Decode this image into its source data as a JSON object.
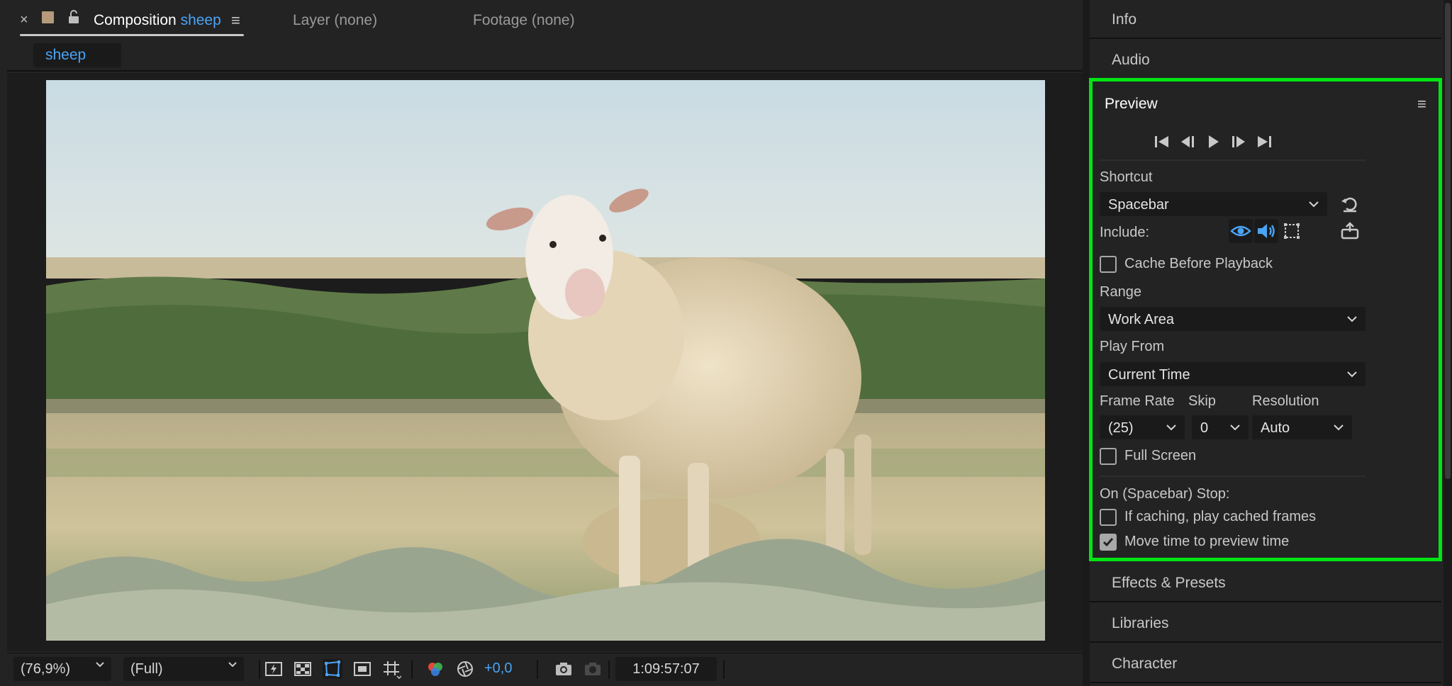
{
  "composition_panel": {
    "tabs": {
      "composition_prefix": "Composition",
      "composition_name": "sheep",
      "layer": "Layer (none)",
      "footage": "Footage (none)"
    },
    "breadcrumb": "sheep",
    "image_description_icon": "sheep-photo",
    "footer": {
      "zoom": "(76,9%)",
      "resolution": "(Full)",
      "exposure": "+0,0",
      "timecode": "1:09:57:07"
    }
  },
  "right_panels": {
    "info": "Info",
    "audio": "Audio",
    "effects": "Effects & Presets",
    "libraries": "Libraries",
    "character": "Character"
  },
  "preview": {
    "title": "Preview",
    "shortcut_label": "Shortcut",
    "shortcut_value": "Spacebar",
    "include_label": "Include:",
    "cache_before_playback": {
      "label": "Cache Before Playback",
      "checked": false
    },
    "range_label": "Range",
    "range_value": "Work Area",
    "play_from_label": "Play From",
    "play_from_value": "Current Time",
    "frame_rate_label": "Frame Rate",
    "frame_rate_value": "(25)",
    "skip_label": "Skip",
    "skip_value": "0",
    "resolution_label": "Resolution",
    "resolution_value": "Auto",
    "full_screen": {
      "label": "Full Screen",
      "checked": false
    },
    "stop_label": "On (Spacebar) Stop:",
    "if_caching": {
      "label": "If caching, play cached frames",
      "checked": false
    },
    "move_time": {
      "label": "Move time to preview time",
      "checked": true
    }
  },
  "colors": {
    "accent_blue": "#4aa4f5",
    "highlight_green": "#00e413",
    "panel_bg": "#232323"
  }
}
